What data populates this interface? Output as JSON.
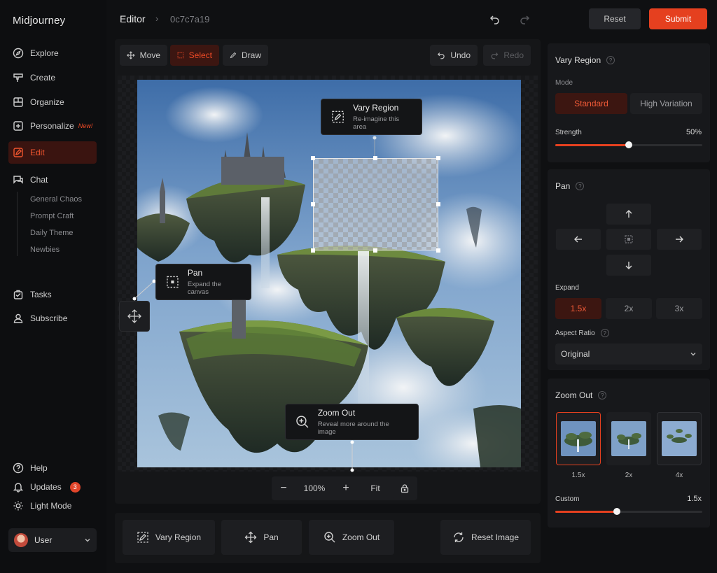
{
  "app": {
    "title": "Midjourney"
  },
  "sidebar": {
    "items": [
      {
        "label": "Explore",
        "icon": "compass-icon"
      },
      {
        "label": "Create",
        "icon": "brush-icon"
      },
      {
        "label": "Organize",
        "icon": "grid-icon"
      },
      {
        "label": "Personalize",
        "icon": "sparkle-icon",
        "badge": "New!"
      },
      {
        "label": "Edit",
        "icon": "edit-icon",
        "active": true
      },
      {
        "label": "Chat",
        "icon": "chat-icon"
      }
    ],
    "chat_rooms": [
      "General Chaos",
      "Prompt Craft",
      "Daily Theme",
      "Newbies"
    ],
    "secondary": [
      {
        "label": "Tasks",
        "icon": "tasks-icon"
      },
      {
        "label": "Subscribe",
        "icon": "user-icon"
      }
    ],
    "footer": [
      {
        "label": "Help",
        "icon": "help-icon"
      },
      {
        "label": "Updates",
        "icon": "bell-icon",
        "badge": "3"
      },
      {
        "label": "Light Mode",
        "icon": "sun-icon"
      }
    ],
    "user": {
      "name": "User"
    }
  },
  "header": {
    "title": "Editor",
    "separator": "›",
    "job_id": "0c7c7a19",
    "reset_label": "Reset",
    "submit_label": "Submit"
  },
  "toolbar": {
    "move": "Move",
    "select": "Select",
    "draw": "Draw",
    "undo": "Undo",
    "redo": "Redo"
  },
  "canvas": {
    "vary_region_callout": {
      "title": "Vary Region",
      "subtitle": "Re-imagine this area"
    },
    "pan_callout": {
      "title": "Pan",
      "subtitle": "Expand the canvas"
    },
    "zoom_callout": {
      "title": "Zoom Out",
      "subtitle": "Reveal more around the image"
    },
    "zoom": {
      "minus": "−",
      "value": "100%",
      "plus": "+",
      "fit": "Fit"
    }
  },
  "actions": {
    "vary_region": "Vary Region",
    "pan": "Pan",
    "zoom_out": "Zoom Out",
    "reset_image": "Reset Image"
  },
  "vary_panel": {
    "title": "Vary Region",
    "mode_label": "Mode",
    "modes": [
      "Standard",
      "High Variation"
    ],
    "selected_mode": "Standard",
    "strength_label": "Strength",
    "strength_value": "50%",
    "strength_fraction": 0.5
  },
  "pan_panel": {
    "title": "Pan",
    "expand_label": "Expand",
    "expand_options": [
      "1.5x",
      "2x",
      "3x"
    ],
    "selected_expand": "1.5x",
    "aspect_label": "Aspect Ratio",
    "aspect_value": "Original"
  },
  "zoom_panel": {
    "title": "Zoom Out",
    "options": [
      "1.5x",
      "2x",
      "4x"
    ],
    "selected": "1.5x",
    "custom_label": "Custom",
    "custom_value": "1.5x",
    "custom_fraction": 0.42
  },
  "colors": {
    "accent": "#e5401f",
    "background": "#0f1012",
    "panel": "#17181b"
  }
}
